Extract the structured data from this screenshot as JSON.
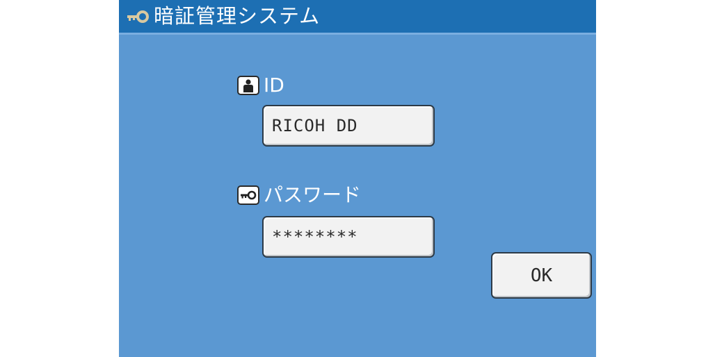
{
  "window": {
    "title": "暗証管理システム",
    "title_icon": "key-icon"
  },
  "login": {
    "id_label": "ID",
    "id_icon": "user-icon",
    "id_value": "RICOH DD",
    "password_label": "パスワード",
    "password_icon": "key-icon",
    "password_value": "********",
    "ok_label": "OK"
  },
  "colors": {
    "background": "#5b98d2",
    "titlebar": "#1d6fb3",
    "field": "#f2f2f2"
  }
}
